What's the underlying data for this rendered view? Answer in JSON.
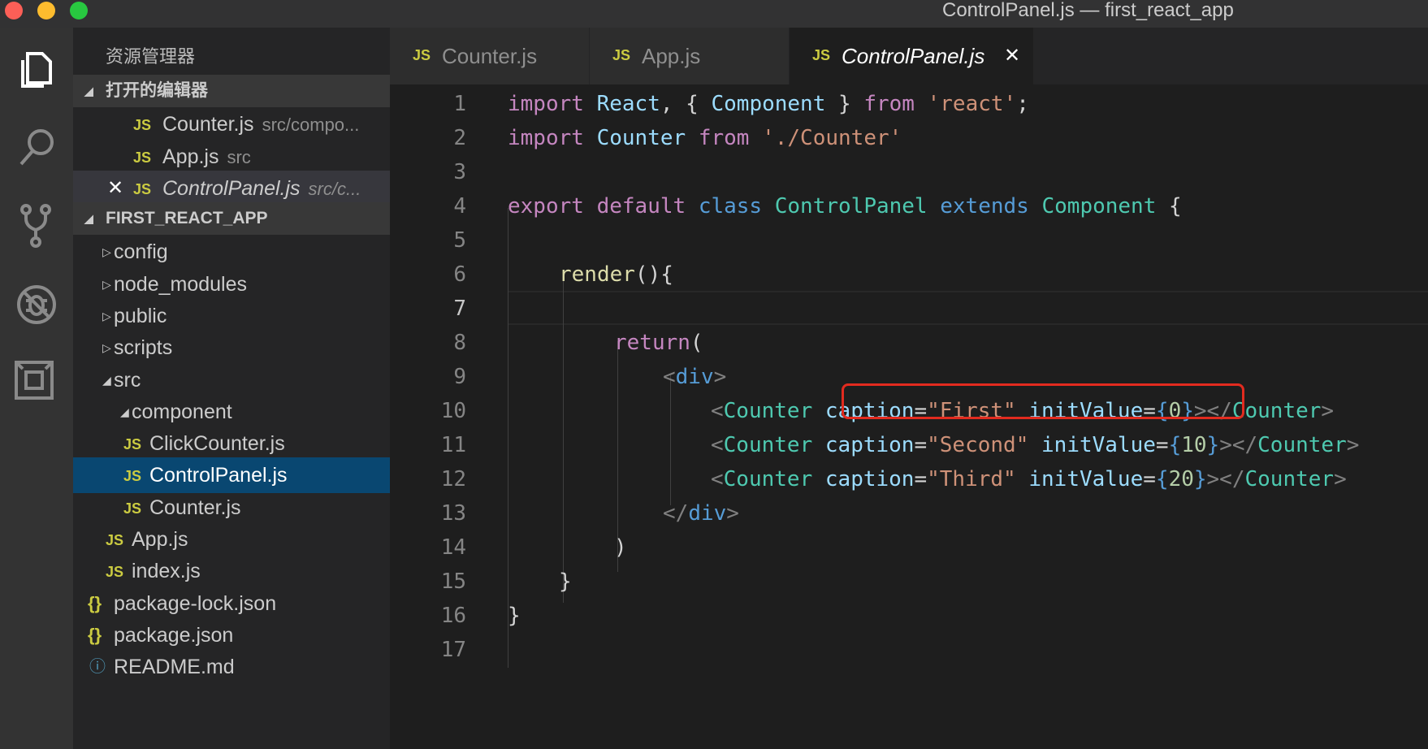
{
  "window": {
    "title": "ControlPanel.js — first_react_app"
  },
  "activity_bar": {
    "icons": [
      "explorer-icon",
      "search-icon",
      "source-control-icon",
      "debug-icon",
      "extensions-icon"
    ]
  },
  "sidebar": {
    "title": "资源管理器",
    "open_editors": {
      "label": "打开的编辑器",
      "items": [
        {
          "badge": "JS",
          "name": "Counter.js",
          "desc": "src/compo..."
        },
        {
          "badge": "JS",
          "name": "App.js",
          "desc": "src"
        },
        {
          "badge": "JS",
          "name": "ControlPanel.js",
          "desc": "src/c...",
          "close": "✕"
        }
      ]
    },
    "project": {
      "label": "FIRST_REACT_APP",
      "items": [
        {
          "name": "config"
        },
        {
          "name": "node_modules"
        },
        {
          "name": "public"
        },
        {
          "name": "scripts"
        },
        {
          "name": "src"
        },
        {
          "name": "component"
        },
        {
          "name": "ClickCounter.js",
          "badge": "JS"
        },
        {
          "name": "ControlPanel.js",
          "badge": "JS"
        },
        {
          "name": "Counter.js",
          "badge": "JS"
        },
        {
          "name": "App.js",
          "badge": "JS"
        },
        {
          "name": "index.js",
          "badge": "JS"
        },
        {
          "name": "package-lock.json",
          "badge": "{}"
        },
        {
          "name": "package.json",
          "badge": "{}"
        },
        {
          "name": "README.md",
          "badge": "ⓘ"
        }
      ]
    }
  },
  "tabs": [
    {
      "badge": "JS",
      "label": "Counter.js"
    },
    {
      "badge": "JS",
      "label": "App.js"
    },
    {
      "badge": "JS",
      "label": "ControlPanel.js",
      "close": "✕"
    }
  ],
  "editor": {
    "line_numbers": [
      "1",
      "2",
      "3",
      "4",
      "5",
      "6",
      "7",
      "8",
      "9",
      "10",
      "11",
      "12",
      "13",
      "14",
      "15",
      "16",
      "17"
    ],
    "lines": {
      "l1": [
        "import",
        " ",
        "React",
        ", { ",
        "Component",
        " } ",
        "from",
        " ",
        "'react'",
        ";"
      ],
      "l2": [
        "import",
        " ",
        "Counter",
        " ",
        "from",
        " ",
        "'./Counter'"
      ],
      "l4": [
        "export",
        " ",
        "default",
        " ",
        "class",
        " ",
        "ControlPanel",
        " ",
        "extends",
        " ",
        "Component",
        " {"
      ],
      "l6": [
        "render",
        "(){"
      ],
      "l8": [
        "return",
        "("
      ],
      "l9": [
        "<",
        "div",
        ">"
      ],
      "l10": [
        "<",
        "Counter",
        " ",
        "caption",
        "=",
        "\"First\"",
        " ",
        "initValue",
        "=",
        "{",
        "0",
        "}",
        "></",
        "Counter",
        ">"
      ],
      "l11": [
        "<",
        "Counter",
        " ",
        "caption",
        "=",
        "\"Second\"",
        " ",
        "initValue",
        "=",
        "{",
        "10",
        "}",
        "></",
        "Counter",
        ">"
      ],
      "l12": [
        "<",
        "Counter",
        " ",
        "caption",
        "=",
        "\"Third\"",
        " ",
        "initValue",
        "=",
        "{",
        "20",
        "}",
        "></",
        "Counter",
        ">"
      ],
      "l13": [
        "</",
        "div",
        ">"
      ],
      "l14": [
        ")"
      ],
      "l15": [
        "}"
      ],
      "l16": [
        "}"
      ]
    }
  },
  "colors": {
    "keyword": "#c586c0",
    "storage": "#569cd6",
    "class": "#4ec9b0",
    "variable": "#9cdcfe",
    "string": "#ce9178",
    "function": "#dcdcaa",
    "highlight_box": "#e22b1f",
    "selected_row": "#094771",
    "js_badge": "#cbcb41"
  }
}
